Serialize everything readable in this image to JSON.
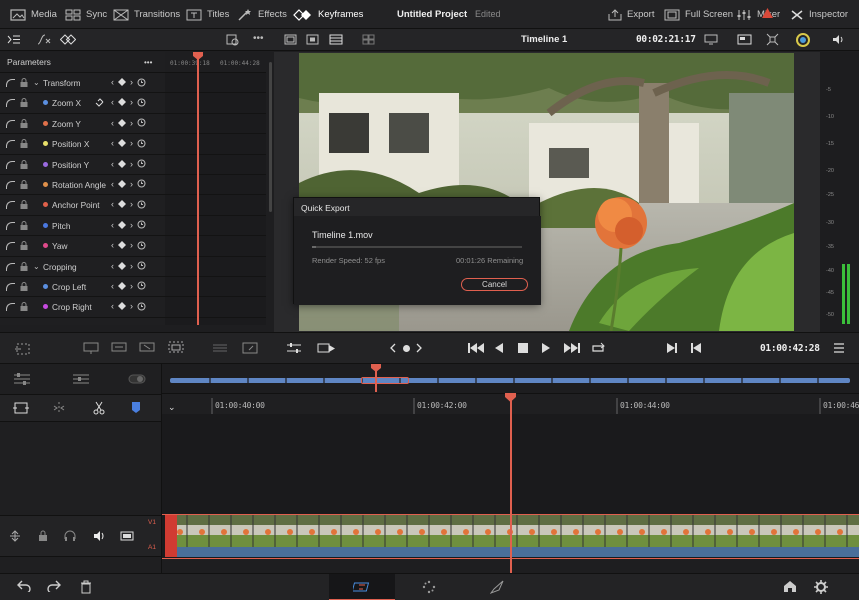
{
  "topbar": {
    "media": "Media",
    "sync": "Sync",
    "transitions": "Transitions",
    "titles": "Titles",
    "effects": "Effects",
    "keyframes": "Keyframes",
    "project": "Untitled Project",
    "status": "Edited",
    "export": "Export",
    "fullscreen": "Full Screen",
    "mixer": "Mixer",
    "inspector": "Inspector"
  },
  "viewer": {
    "timeline_name": "Timeline 1",
    "timecode": "00:02:21:17"
  },
  "params": {
    "header": "Parameters",
    "more": "•••",
    "kf_ruler": [
      "01:00:39:18",
      "01:00:44:28"
    ],
    "rows": [
      {
        "label": "Transform",
        "group": true
      },
      {
        "label": "Zoom X",
        "color": "#5b8fe0"
      },
      {
        "label": "Zoom Y",
        "color": "#e0704a"
      },
      {
        "label": "Position X",
        "color": "#e8e06a"
      },
      {
        "label": "Position Y",
        "color": "#9a6ae0"
      },
      {
        "label": "Rotation Angle",
        "color": "#e0904a"
      },
      {
        "label": "Anchor Point",
        "color": "#e0604a"
      },
      {
        "label": "Pitch",
        "color": "#4a78e0"
      },
      {
        "label": "Yaw",
        "color": "#e04a8a"
      },
      {
        "label": "Cropping",
        "group": true
      },
      {
        "label": "Crop Left",
        "color": "#5b8fe0"
      },
      {
        "label": "Crop Right",
        "color": "#c64ae0"
      }
    ]
  },
  "meter": {
    "labels": [
      "-5",
      "-10",
      "-15",
      "-20",
      "-25",
      "-30",
      "-35",
      "-40",
      "-45",
      "-50"
    ]
  },
  "quick_export": {
    "title": "Quick Export",
    "file": "Timeline 1.mov",
    "speed": "Render Speed: 52 fps",
    "remaining": "00:01:26 Remaining",
    "cancel": "Cancel",
    "progress": 0.02
  },
  "controls": {
    "timecode": "01:00:42:28"
  },
  "ruler": {
    "ticks": [
      "01:00:40:00",
      "01:00:42:00",
      "01:00:44:00",
      "01:00:46"
    ]
  },
  "tracks": {
    "video": "V1",
    "audio": "A1"
  },
  "colors": {
    "accent": "#e0604f",
    "audio": "#4a6f9a",
    "mini_clip": "#5f86c4"
  }
}
